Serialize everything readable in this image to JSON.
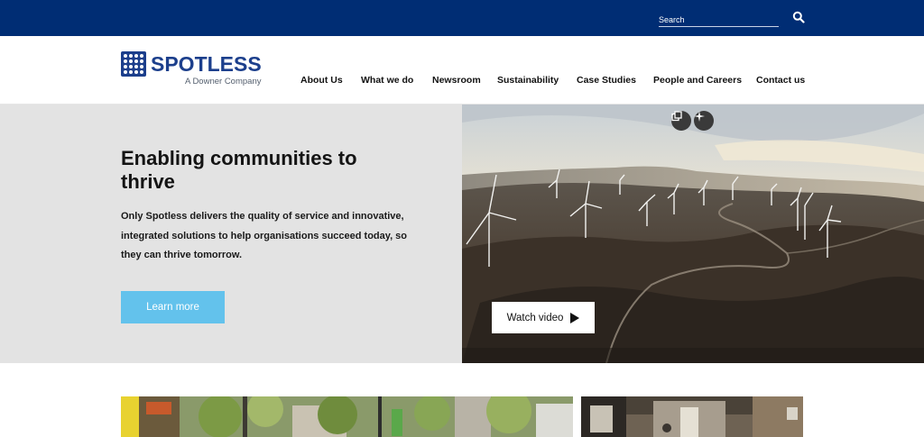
{
  "topbar": {
    "search_placeholder": "Search",
    "search_icon": "search-icon",
    "bg_color": "#002d74"
  },
  "brand": {
    "name": "SPOTLESS",
    "tagline": "A Downer Company",
    "color": "#1c3f8c"
  },
  "nav": {
    "items": [
      {
        "label": "About Us"
      },
      {
        "label": "What we do"
      },
      {
        "label": "Newsroom"
      },
      {
        "label": "Sustainability"
      },
      {
        "label": "Case Studies"
      },
      {
        "label": "People and Careers"
      },
      {
        "label": "Contact us"
      }
    ]
  },
  "hero": {
    "title": "Enabling communities to thrive",
    "body": "Only Spotless delivers the quality of service and innovative, integrated solutions to help organisations succeed today, so they can thrive tomorrow.",
    "cta_label": "Learn more",
    "cta_color": "#63c2ec",
    "video_label": "Watch video",
    "video_icon": "play-icon",
    "overlay_icons": [
      "copy-icon",
      "sparkle-icon"
    ]
  },
  "cards": [
    {
      "icon": "city-street-image"
    },
    {
      "icon": "arcade-image"
    }
  ]
}
